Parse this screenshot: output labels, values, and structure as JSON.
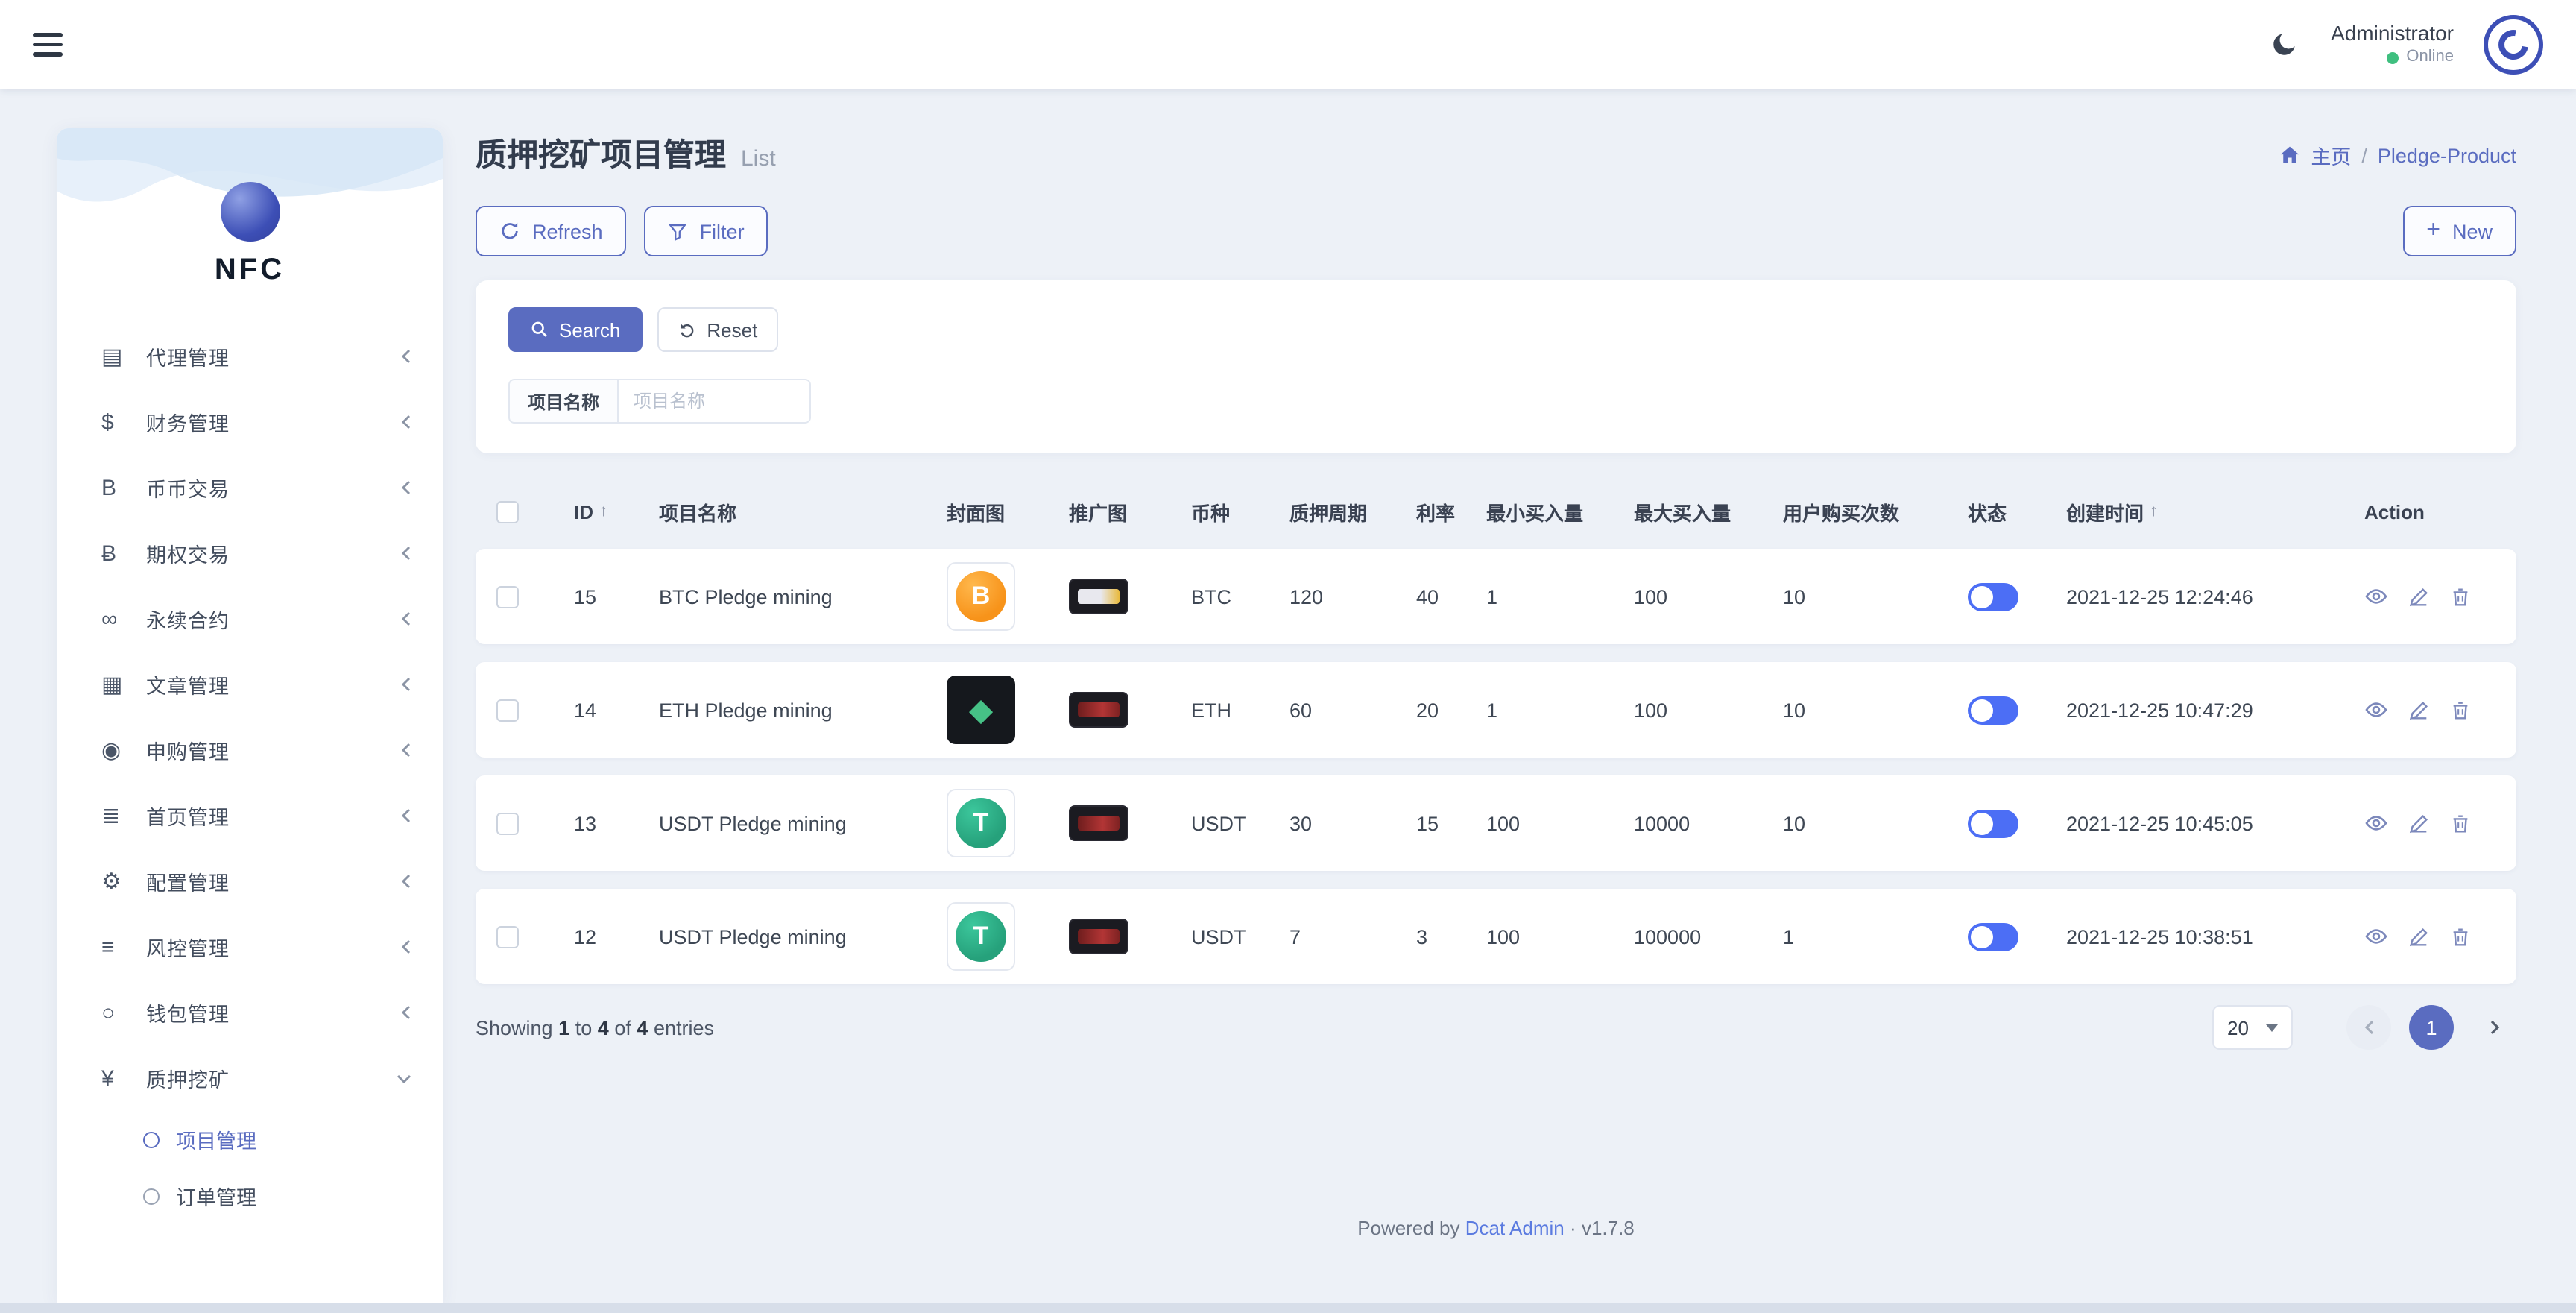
{
  "colors": {
    "primary": "#5a6cc0",
    "toggle_on": "#4c6ef5",
    "online_green": "#3fbf7f",
    "page_background": "#edf1f7",
    "btc_orange": "#f7931a",
    "usdt_green": "#26a17b",
    "eth_tile": "#15181d"
  },
  "topbar": {
    "user_name": "Administrator",
    "user_status": "Online"
  },
  "sidebar": {
    "logo_text": "NFC",
    "items": [
      {
        "label": "代理管理",
        "icon": "id-card-icon",
        "glyph": "▤"
      },
      {
        "label": "财务管理",
        "icon": "dollar-icon",
        "glyph": "$"
      },
      {
        "label": "币币交易",
        "icon": "coin-b-icon",
        "glyph": "B"
      },
      {
        "label": "期权交易",
        "icon": "bitcoin-icon",
        "glyph": "Ƀ"
      },
      {
        "label": "永续合约",
        "icon": "link-icon",
        "glyph": "∞"
      },
      {
        "label": "文章管理",
        "icon": "article-icon",
        "glyph": "▦"
      },
      {
        "label": "申购管理",
        "icon": "subscribe-icon",
        "glyph": "◉"
      },
      {
        "label": "首页管理",
        "icon": "homepage-icon",
        "glyph": "≣"
      },
      {
        "label": "配置管理",
        "icon": "wrench-icon",
        "glyph": "⚙"
      },
      {
        "label": "风控管理",
        "icon": "risk-icon",
        "glyph": "≡"
      },
      {
        "label": "钱包管理",
        "icon": "wallet-icon",
        "glyph": "○"
      },
      {
        "label": "质押挖矿",
        "icon": "yen-icon",
        "glyph": "¥",
        "expanded": true,
        "children": [
          {
            "label": "项目管理",
            "active": true
          },
          {
            "label": "订单管理",
            "active": false
          }
        ]
      }
    ]
  },
  "page": {
    "title": "质押挖矿项目管理",
    "subtitle": "List",
    "breadcrumb": {
      "home_label": "主页",
      "sep": "/",
      "current": "Pledge-Product"
    }
  },
  "toolbar": {
    "refresh_label": "Refresh",
    "filter_label": "Filter",
    "new_plus": "+",
    "new_label": "New"
  },
  "filter_panel": {
    "search_label": "Search",
    "reset_label": "Reset",
    "field_label": "项目名称",
    "placeholder": "项目名称"
  },
  "table": {
    "sort_arrow": "↑",
    "columns": [
      "ID",
      "项目名称",
      "封面图",
      "推广图",
      "币种",
      "质押周期",
      "利率",
      "最小买入量",
      "最大买入量",
      "用户购买次数",
      "状态",
      "创建时间",
      "Action"
    ],
    "rows": [
      {
        "id": "15",
        "name": "BTC Pledge mining",
        "cover_type": "btc",
        "cover_glyph": "B",
        "coin": "BTC",
        "period": "120",
        "rate": "40",
        "min_buy": "1",
        "max_buy": "100",
        "buy_count": "10",
        "status_on": true,
        "created": "2021-12-25 12:24:46"
      },
      {
        "id": "14",
        "name": "ETH Pledge mining",
        "cover_type": "eth",
        "cover_glyph": "◆",
        "coin": "ETH",
        "period": "60",
        "rate": "20",
        "min_buy": "1",
        "max_buy": "100",
        "buy_count": "10",
        "status_on": true,
        "created": "2021-12-25 10:47:29"
      },
      {
        "id": "13",
        "name": "USDT Pledge mining",
        "cover_type": "usdt",
        "cover_glyph": "T",
        "coin": "USDT",
        "period": "30",
        "rate": "15",
        "min_buy": "100",
        "max_buy": "10000",
        "buy_count": "10",
        "status_on": true,
        "created": "2021-12-25 10:45:05"
      },
      {
        "id": "12",
        "name": "USDT Pledge mining",
        "cover_type": "usdt",
        "cover_glyph": "T",
        "coin": "USDT",
        "period": "7",
        "rate": "3",
        "min_buy": "100",
        "max_buy": "100000",
        "buy_count": "1",
        "status_on": true,
        "created": "2021-12-25 10:38:51"
      }
    ]
  },
  "footer": {
    "showing": {
      "s1": "Showing",
      "n1": "1",
      "s2": "to",
      "n2": "4",
      "s3": "of",
      "n3": "4",
      "s4": "entries"
    }
  },
  "pagination": {
    "page_size": "20",
    "current_page": "1"
  },
  "powered": {
    "prefix": "Powered by",
    "link": "Dcat Admin",
    "sep": "·",
    "version": "v1.7.8"
  }
}
